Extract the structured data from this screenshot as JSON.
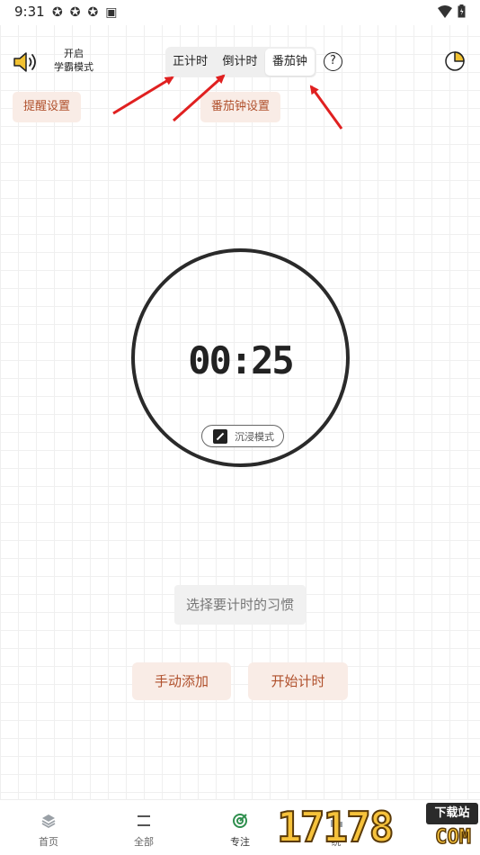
{
  "status_bar": {
    "time": "9:31",
    "notif_icons": [
      "app-icon",
      "app-icon",
      "app-icon",
      "a-icon"
    ]
  },
  "header": {
    "mode_toggle": {
      "line1": "开启",
      "line2": "学霸模式"
    },
    "segments": [
      {
        "label": "正计时",
        "active": false
      },
      {
        "label": "倒计时",
        "active": false
      },
      {
        "label": "番茄钟",
        "active": true
      }
    ],
    "help": "?"
  },
  "settings": {
    "remind": "提醒设置",
    "tomato": "番茄钟设置"
  },
  "timer": {
    "display": "00:25",
    "immersive": "沉浸模式"
  },
  "habit_select": "选择要计时的习惯",
  "actions": {
    "manual_add": "手动添加",
    "start_timer": "开始计时"
  },
  "tabbar": {
    "items": [
      {
        "label": "首页",
        "icon": "home-icon"
      },
      {
        "label": "全部",
        "icon": "list-icon"
      },
      {
        "label": "专注",
        "icon": "target-icon"
      },
      {
        "label": "统",
        "icon": "stats-icon"
      }
    ]
  },
  "watermark": {
    "digits": "17178",
    "tag": "下载站",
    "domain": "COM"
  },
  "colors": {
    "accent": "#b0502c",
    "pill_bg": "#f9ece6",
    "arrow": "#e02020"
  }
}
